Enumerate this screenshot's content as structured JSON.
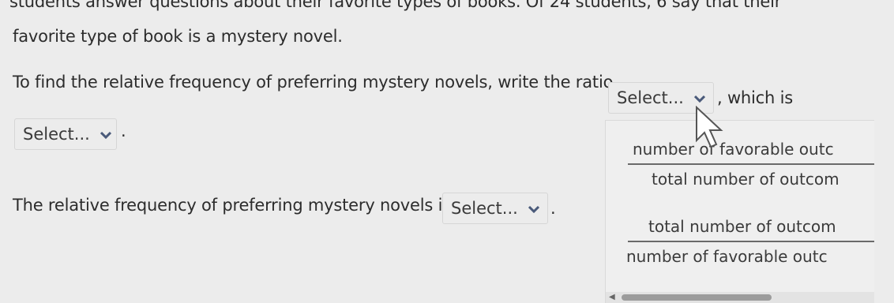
{
  "question": {
    "line1": "students answer questions about their favorite types of books. Of 24 students, 6 say that their",
    "line2": "favorite type of book is a mystery novel.",
    "line3": "To find the relative frequency of preferring mystery novels, write the ratio",
    "line3_end": ", which is",
    "line4": "The relative frequency of preferring mystery novels is",
    "period": "."
  },
  "selects": {
    "ratio": {
      "label": "Select..."
    },
    "value": {
      "label": "Select..."
    },
    "frequency": {
      "label": "Select..."
    }
  },
  "dropdown_options": [
    {
      "numerator": "number of favorable outc",
      "denominator": "total number of outcom"
    },
    {
      "numerator": "total number of outcom",
      "denominator": "number of favorable outc"
    }
  ],
  "icons": {
    "chevron": "chevron-down-icon",
    "cursor": "mouse-pointer-icon",
    "scroll": "scroll-left-arrow-icon"
  }
}
